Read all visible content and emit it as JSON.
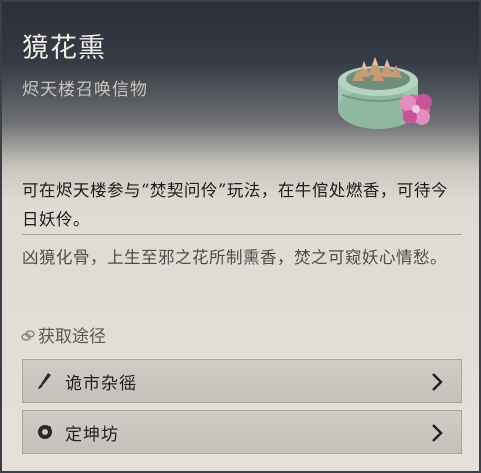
{
  "item": {
    "name": "獍花熏",
    "subtitle": "烬天楼召唤信物",
    "description": "可在烬天楼参与“焚契问伶”玩法，在牛倌处燃香，可待今日妖伶。",
    "lore": "凶獍化骨，上生至邪之花所制熏香，焚之可窥妖心情愁。"
  },
  "sources": {
    "title": "获取途径",
    "items": [
      {
        "label": "诡市杂徭",
        "icon": "brush-icon"
      },
      {
        "label": "定坤坊",
        "icon": "ring-seal-icon"
      }
    ]
  },
  "colors": {
    "header_dark": "#2a2f39",
    "panel_light": "#e4e1da",
    "row_bg": "#cbc8c1",
    "censer_green": "#9ec4ad",
    "flower_pink": "#d36aa6"
  }
}
